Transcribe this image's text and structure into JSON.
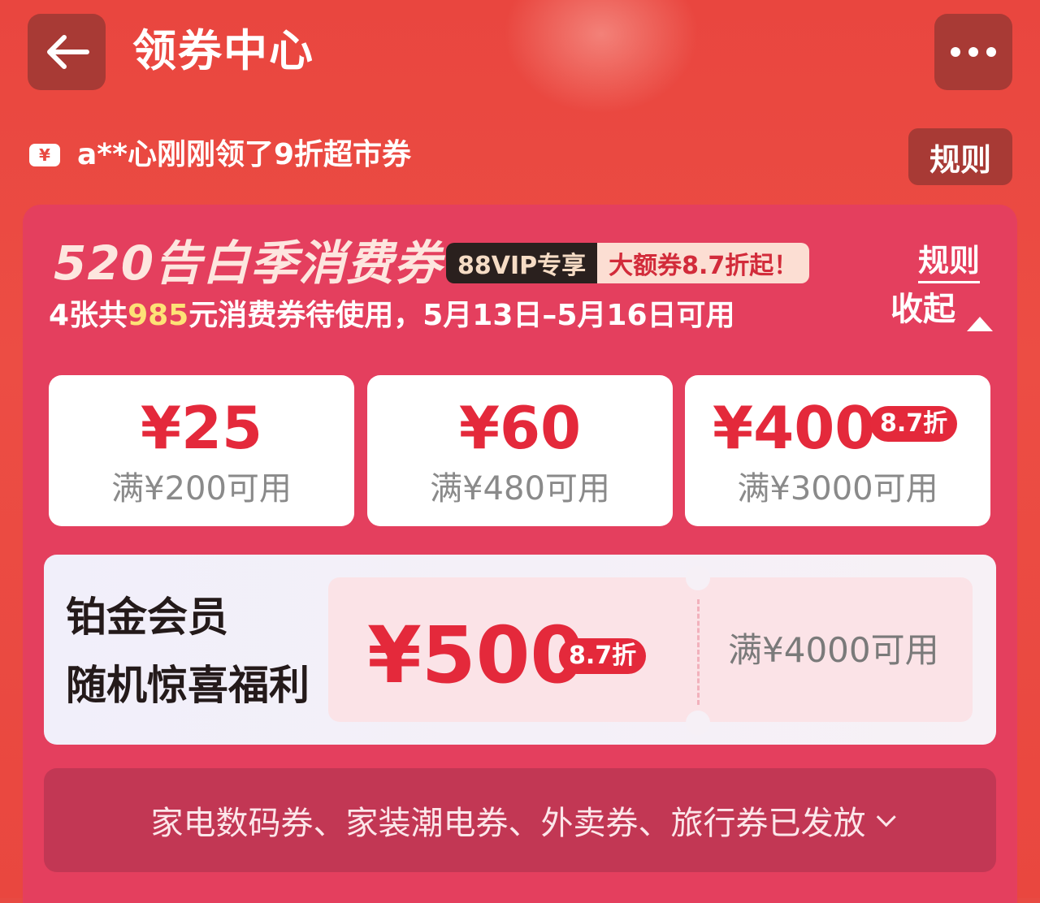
{
  "header": {
    "title": "领券中心"
  },
  "ticker": {
    "icon": "¥",
    "text": "a**心刚刚领了9折超市券",
    "rules": "规则"
  },
  "promo": {
    "title": "520告白季消费券",
    "vip_label": "88VIP专享",
    "vip_tag": "大额券8.7折起！",
    "rules": "规则",
    "collapse": "收起",
    "subtitle_prefix": "4张共",
    "subtitle_amount": "985",
    "subtitle_suffix": "元消费券待使用，5月13日–5月16日可用"
  },
  "coupons": [
    {
      "amount": "¥25",
      "condition": "满¥200可用"
    },
    {
      "amount": "¥60",
      "condition": "满¥480可用"
    },
    {
      "amount": "¥400",
      "condition": "满¥3000可用",
      "discount": "8.7折"
    }
  ],
  "platinum": {
    "line1": "铂金会员",
    "line2": "随机惊喜福利",
    "amount": "¥500",
    "discount": "8.7折",
    "condition": "满¥4000可用"
  },
  "footer": {
    "text": "家电数码券、家装潮电券、外卖券、旅行券已发放"
  },
  "colors": {
    "background": "#e84a42",
    "panel": "#e43f5e",
    "accent_red": "#e4293b",
    "highlight_yellow": "#fde276"
  }
}
